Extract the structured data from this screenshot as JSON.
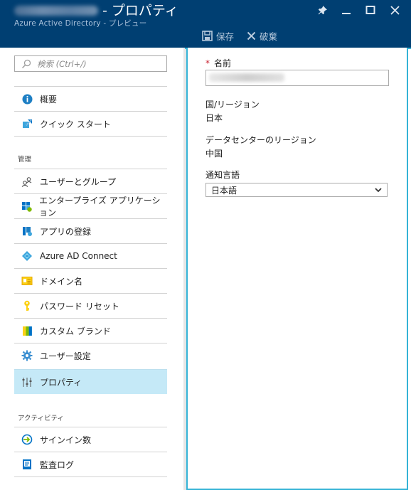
{
  "header": {
    "title": "- プロパティ",
    "subtitle": "Azure Active Directory - プレビュー"
  },
  "window_controls": [
    "pin-icon",
    "minimize-icon",
    "maximize-icon",
    "close-icon"
  ],
  "toolbar": {
    "save_label": "保存",
    "discard_label": "破棄"
  },
  "search": {
    "placeholder": "検索 (Ctrl+/)"
  },
  "sidebar": {
    "top_items": [
      {
        "label": "概要",
        "icon": "info-icon"
      },
      {
        "label": "クイック スタート",
        "icon": "quickstart-icon"
      }
    ],
    "section_manage": "管理",
    "manage_items": [
      {
        "label": "ユーザーとグループ",
        "icon": "users-icon"
      },
      {
        "label": "エンタープライズ アプリケーション",
        "icon": "enterprise-apps-icon"
      },
      {
        "label": "アプリの登録",
        "icon": "app-registrations-icon"
      },
      {
        "label": "Azure AD Connect",
        "icon": "ad-connect-icon"
      },
      {
        "label": "ドメイン名",
        "icon": "domain-icon"
      },
      {
        "label": "パスワード リセット",
        "icon": "key-icon"
      },
      {
        "label": "カスタム ブランド",
        "icon": "branding-icon"
      },
      {
        "label": "ユーザー設定",
        "icon": "gear-icon"
      },
      {
        "label": "プロパティ",
        "icon": "properties-icon",
        "active": true
      }
    ],
    "section_activity": "アクティビティ",
    "activity_items": [
      {
        "label": "サインイン数",
        "icon": "signin-icon"
      },
      {
        "label": "監査ログ",
        "icon": "audit-log-icon"
      }
    ]
  },
  "properties": {
    "name_label": "名前",
    "required_marker": "*",
    "country_label": "国/リージョン",
    "country_value": "日本",
    "datacenter_label": "データセンターのリージョン",
    "datacenter_value": "中国",
    "language_label": "通知言語",
    "language_value": "日本語"
  },
  "colors": {
    "header_bg": "#003f72",
    "active_item_bg": "#c5e9f7",
    "content_border": "#35b3d6",
    "required": "#c9202f"
  }
}
